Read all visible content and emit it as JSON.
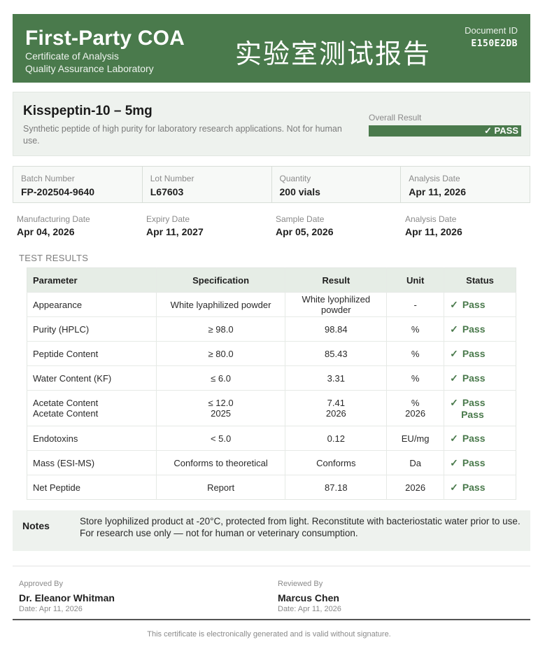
{
  "header": {
    "brand": "First-Party COA",
    "subtitle1": "Certificate of Analysis",
    "subtitle2": "Quality Assurance Laboratory",
    "chinese_title": "实验室测试报告",
    "doc_id_label": "Document ID",
    "doc_id": "E150E2DB",
    "color": "#4a7a4c"
  },
  "product": {
    "name": "Kisspeptin-10 – 5mg",
    "description": "Synthetic peptide of high purity for laboratory research applications. Not for human use.",
    "overall_label": "Overall Result",
    "overall_value": "✓ PASS"
  },
  "batch_info": [
    {
      "label": "Batch Number",
      "value": "FP-202504-9640"
    },
    {
      "label": "Lot Number",
      "value": "L67603"
    },
    {
      "label": "Quantity",
      "value": "200 vials"
    },
    {
      "label": "Analysis Date",
      "value": "Apr 11, 2026"
    }
  ],
  "dates": [
    {
      "label": "Manufacturing Date",
      "value": "Apr 04, 2026"
    },
    {
      "label": "Expiry Date",
      "value": "Apr 11, 2027"
    },
    {
      "label": "Sample Date",
      "value": "Apr 05, 2026"
    },
    {
      "label": "Analysis Date",
      "value": "Apr 11, 2026"
    }
  ],
  "test_results": {
    "section_title": "TEST RESULTS",
    "headers": {
      "parameter": "Parameter",
      "specification": "Specification",
      "result": "Result",
      "unit": "Unit",
      "status": "Status"
    },
    "rows": [
      {
        "parameter": "Appearance",
        "specification": "White lyaphilized powder",
        "result": "White lyophilized powder",
        "unit": "-",
        "status": "Pass"
      },
      {
        "parameter": "Purity (HPLC)",
        "specification": "≥ 98.0",
        "result": "98.84",
        "unit": "%",
        "status": "Pass"
      },
      {
        "parameter": "Peptide Content",
        "specification": "≥ 80.0",
        "result": "85.43",
        "unit": "%",
        "status": "Pass"
      },
      {
        "parameter": "Water Content (KF)",
        "specification": "≤ 6.0",
        "result": "3.31",
        "unit": "%",
        "status": "Pass"
      },
      {
        "parameter": "Acetate Content",
        "parameter2": "Acetate Content",
        "specification": "≤ 12.0",
        "specification2": "2025",
        "result": "7.41",
        "result2": "2026",
        "unit": "%",
        "unit2": "2026",
        "status": "Pass",
        "status2": "Pass"
      },
      {
        "parameter": "Endotoxins",
        "specification": "< 5.0",
        "result": "0.12",
        "unit": "EU/mg",
        "status": "Pass"
      },
      {
        "parameter": "Mass (ESI-MS)",
        "specification": "Conforms to theoretical",
        "result": "Conforms",
        "unit": "Da",
        "status": "Pass"
      },
      {
        "parameter": "Net Peptide",
        "specification": "Report",
        "result": "87.18",
        "unit": "2026",
        "status": "Pass"
      }
    ]
  },
  "notes": {
    "title": "Notes",
    "text": "Store lyophilized product at -20°C, protected from light. Reconstitute with bacteriostatic water prior to use. For research use only — not for human or veterinary consumption."
  },
  "approval": {
    "approved_label": "Approved By",
    "approved_name": "Dr. Eleanor Whitman",
    "approved_date": "Date: Apr 11, 2026",
    "reviewed_label": "Reviewed By",
    "reviewed_name": "Marcus Chen",
    "reviewed_date": "Date: Apr 11, 2026"
  },
  "footer": "This certificate is electronically generated and is valid without signature."
}
